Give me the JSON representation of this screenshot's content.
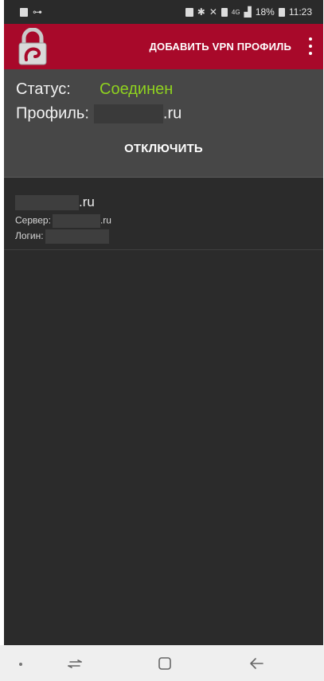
{
  "status_bar": {
    "battery": "18%",
    "time": "11:23",
    "network": "4G"
  },
  "app_bar": {
    "add_profile_label": "ДОБАВИТЬ VPN ПРОФИЛЬ",
    "brand_color": "#a8092a"
  },
  "status": {
    "status_label": "Статус:",
    "status_value": "Соединен",
    "status_color": "#8fd21f",
    "profile_label": "Профиль:",
    "profile_suffix": ".ru",
    "disconnect_label": "ОТКЛЮЧИТЬ"
  },
  "profiles": [
    {
      "title_suffix": ".ru",
      "server_label": "Сервер:",
      "server_suffix": ".ru",
      "login_label": "Логин:"
    }
  ],
  "icons": {
    "app": "padlock-icon",
    "overflow": "more-vert-icon",
    "nav_recent": "recent-apps-icon",
    "nav_home": "home-icon",
    "nav_back": "back-icon"
  }
}
